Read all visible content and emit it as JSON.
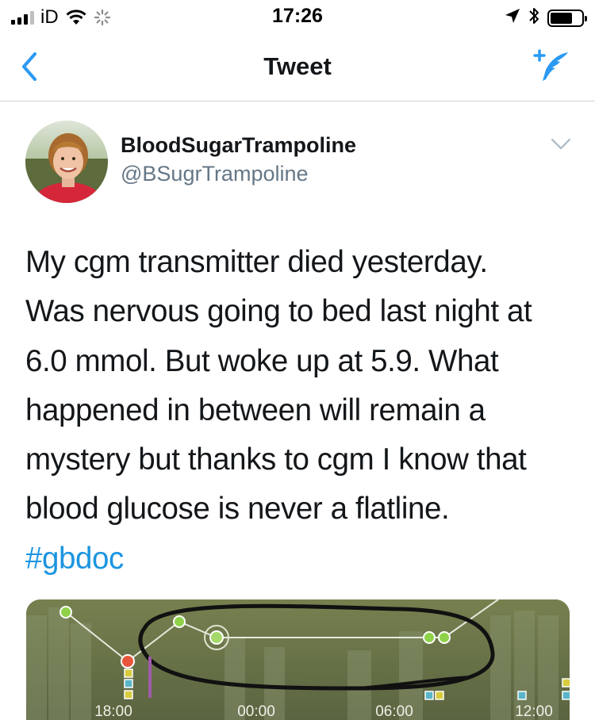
{
  "status_bar": {
    "carrier": "iD",
    "time": "17:26"
  },
  "nav": {
    "title": "Tweet"
  },
  "tweet": {
    "display_name": "BloodSugarTrampoline",
    "handle": "@BSugrTrampoline",
    "text_lines": [
      "My cgm transmitter died yesterday.",
      "Was nervous going to bed last night at",
      "6.0 mmol. But woke up at 5.9. What",
      "happened in between will remain a",
      "mystery but thanks to cgm I know that",
      "blood glucose is never a flatline."
    ],
    "hashtag": "#gbdoc"
  },
  "media": {
    "time_labels": [
      "18:00",
      "00:00",
      "06:00",
      "12:00"
    ]
  },
  "colors": {
    "link_blue": "#1b95e0",
    "nav_blue": "#2b9af3",
    "secondary_text": "#657786",
    "divider": "#d4d4d8",
    "graph_point_green": "#8fd24a",
    "graph_point_red": "#e8553a"
  },
  "icons": {
    "back": "chevron-left-icon",
    "compose": "compose-feather-icon",
    "more": "chevron-down-icon",
    "location": "location-arrow-icon",
    "bluetooth": "bluetooth-icon",
    "battery": "battery-icon",
    "wifi": "wifi-icon",
    "signal": "signal-bars-icon"
  }
}
